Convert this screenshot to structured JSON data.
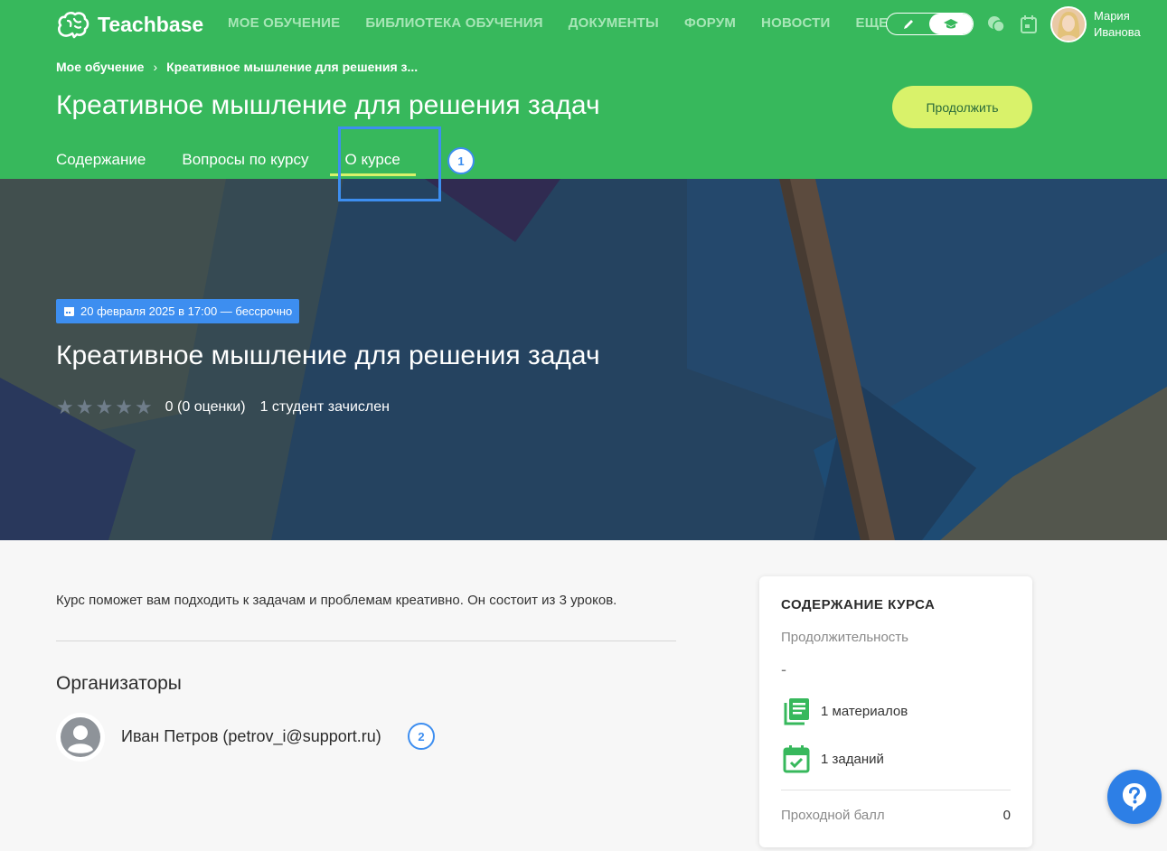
{
  "header": {
    "brand": "Teachbase",
    "nav": [
      "МОЕ ОБУЧЕНИЕ",
      "БИБЛИОТЕКА ОБУЧЕНИЯ",
      "ДОКУМЕНТЫ",
      "ФОРУМ",
      "НОВОСТИ",
      "ЕЩЕ"
    ],
    "user": {
      "first_name": "Мария",
      "last_name": "Иванова"
    }
  },
  "breadcrumb": {
    "root": "Мое обучение",
    "current": "Креативное мышление для решения з..."
  },
  "course": {
    "title": "Креативное мышление для решения задач",
    "continue_label": "Продолжить",
    "date_badge": "20 февраля 2025 в 17:00 — бессрочно",
    "rating_text": "0 (0 оценки)",
    "students_text": "1 студент зачислен",
    "rating_value": 0,
    "rating_max": 5,
    "description": "Курс поможет вам подходить к задачам и проблемам креативно. Он состоит из 3 уроков."
  },
  "tabs": [
    "Содержание",
    "Вопросы по курсу",
    "О курсе"
  ],
  "markers": [
    "1",
    "2"
  ],
  "organizers": {
    "title": "Организаторы",
    "people": [
      {
        "name": "Иван Петров (petrov_i@support.ru)"
      }
    ]
  },
  "summary": {
    "title": "СОДЕРЖАНИЕ КУРСА",
    "duration_label": "Продолжительность",
    "duration_value": "-",
    "materials": "1 материалов",
    "assignments": "1 заданий",
    "pass_label": "Проходной балл",
    "pass_value": "0"
  },
  "colors": {
    "header_green": "#37b85c",
    "accent_lime": "#d9f26a",
    "highlight_blue": "#3d8ef0"
  },
  "icons": [
    "brain-logo-icon",
    "pencil-icon",
    "graduation-cap-icon",
    "chat-icon",
    "calendar-icon",
    "star-icon",
    "user-placeholder-icon",
    "materials-icon",
    "assignment-icon",
    "help-icon"
  ]
}
